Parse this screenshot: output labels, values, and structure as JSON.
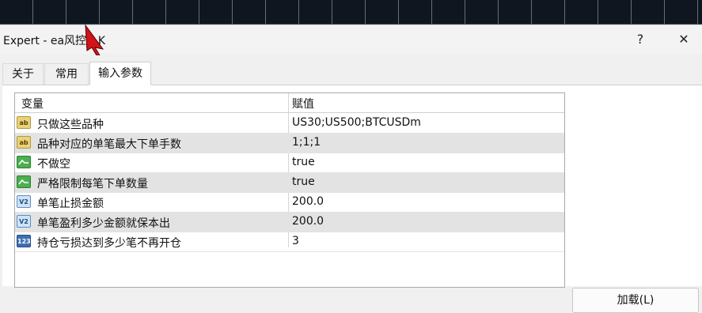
{
  "window": {
    "title": "Expert - ea风控_LK",
    "help_label": "?",
    "close_label": "✕"
  },
  "tabs": [
    {
      "label": "关于",
      "active": false
    },
    {
      "label": "常用",
      "active": false
    },
    {
      "label": "输入参数",
      "active": true
    }
  ],
  "grid": {
    "headers": {
      "variable": "变量",
      "value": "赋值"
    },
    "rows": [
      {
        "type": "string",
        "icon": "ab",
        "name": "只做这些品种",
        "value": "US30;US500;BTCUSDm"
      },
      {
        "type": "string",
        "icon": "ab",
        "name": "品种对应的单笔最大下单手数",
        "value": "1;1;1"
      },
      {
        "type": "bool",
        "icon": "bool",
        "name": "不做空",
        "value": "true"
      },
      {
        "type": "bool",
        "icon": "bool",
        "name": "严格限制每笔下单数量",
        "value": "true"
      },
      {
        "type": "double",
        "icon": "V2",
        "name": "单笔止损金额",
        "value": "200.0"
      },
      {
        "type": "double",
        "icon": "V2",
        "name": "单笔盈利多少金额就保本出",
        "value": "200.0"
      },
      {
        "type": "int",
        "icon": "123",
        "name": "持仓亏损达到多少笔不再开仓",
        "value": "3"
      }
    ]
  },
  "buttons": {
    "load_label": "加载(L)"
  },
  "colors": {
    "alt_row": "#e3e3e3",
    "chart_background": "#0f1620"
  }
}
